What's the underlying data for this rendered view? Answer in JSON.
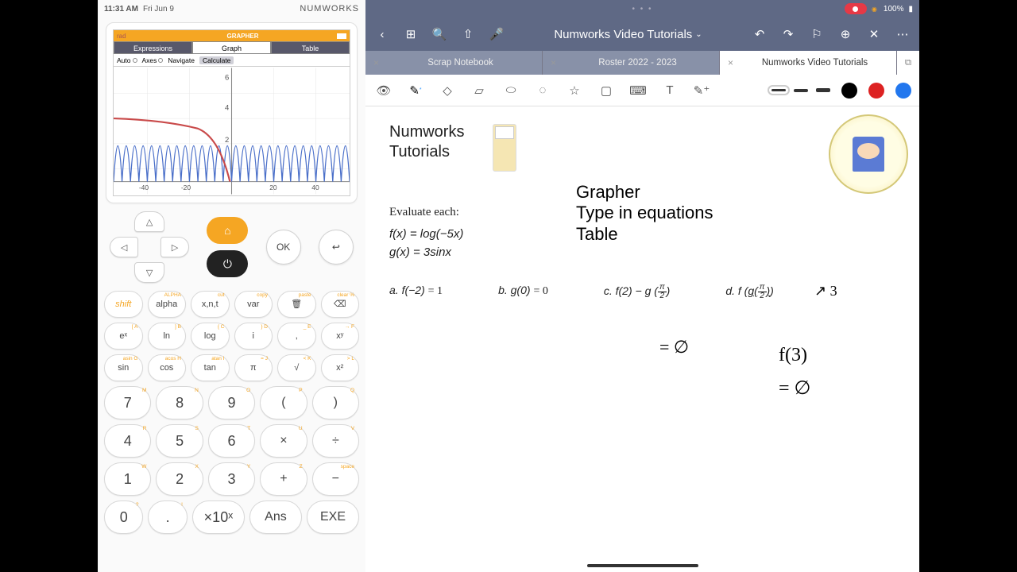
{
  "calc_status": {
    "time": "11:31 AM",
    "date": "Fri Jun 9",
    "brand": "NUMWORKS"
  },
  "screen": {
    "mode": "rad",
    "app_title": "GRAPHER",
    "tabs": [
      "Expressions",
      "Graph",
      "Table"
    ],
    "active_tab": 1,
    "toolbar": {
      "auto": "Auto",
      "axes": "Axes",
      "navigate": "Navigate",
      "calculate": "Calculate"
    },
    "y_ticks": [
      "6",
      "4",
      "2"
    ],
    "x_ticks": [
      "-40",
      "-20",
      "20",
      "40"
    ]
  },
  "nav": {
    "ok": "OK",
    "back": "↩"
  },
  "func_keys": [
    [
      {
        "m": "shift",
        "s": ""
      },
      {
        "m": "alpha",
        "s": "ALPHA"
      },
      {
        "m": "x,n,t",
        "s": "cut"
      },
      {
        "m": "var",
        "s": "copy"
      },
      {
        "m": "🗑",
        "s": "paste"
      },
      {
        "m": "⌫",
        "s": "clear %"
      }
    ],
    [
      {
        "m": "eˣ",
        "s": "[  A"
      },
      {
        "m": "ln",
        "s": "]  B"
      },
      {
        "m": "log",
        "s": "{  C"
      },
      {
        "m": "i",
        "s": "}  D"
      },
      {
        "m": ",",
        "s": "_  E"
      },
      {
        "m": "xʸ",
        "s": "→  F"
      }
    ],
    [
      {
        "m": "sin",
        "s": "asin G"
      },
      {
        "m": "cos",
        "s": "acos H"
      },
      {
        "m": "tan",
        "s": "atan I"
      },
      {
        "m": "π",
        "s": "=  J"
      },
      {
        "m": "√",
        "s": "<  K"
      },
      {
        "m": "x²",
        "s": ">  L"
      }
    ]
  ],
  "num_keys": [
    [
      {
        "m": "7",
        "s": "M"
      },
      {
        "m": "8",
        "s": "N"
      },
      {
        "m": "9",
        "s": "O"
      },
      {
        "m": "(",
        "s": "P"
      },
      {
        "m": ")",
        "s": "Q"
      }
    ],
    [
      {
        "m": "4",
        "s": "R"
      },
      {
        "m": "5",
        "s": "S"
      },
      {
        "m": "6",
        "s": "T"
      },
      {
        "m": "×",
        "s": "U"
      },
      {
        "m": "÷",
        "s": "V"
      }
    ],
    [
      {
        "m": "1",
        "s": "W"
      },
      {
        "m": "2",
        "s": "X"
      },
      {
        "m": "3",
        "s": "Y"
      },
      {
        "m": "+",
        "s": "Z"
      },
      {
        "m": "−",
        "s": "space"
      }
    ],
    [
      {
        "m": "0",
        "s": "?"
      },
      {
        "m": ".",
        "s": "!"
      },
      {
        "m": "×10ˣ",
        "s": ""
      },
      {
        "m": "Ans",
        "s": ""
      },
      {
        "m": "EXE",
        "s": ""
      }
    ]
  ],
  "note": {
    "status": {
      "battery": "100%"
    },
    "toolbar": {
      "title": "Numworks Video Tutorials"
    },
    "tabs": [
      {
        "label": "Scrap Notebook",
        "active": false
      },
      {
        "label": "Roster 2022 - 2023",
        "active": false
      },
      {
        "label": "Numworks Video Tutorials",
        "active": true
      }
    ],
    "content": {
      "heading1": "Numworks",
      "heading2": "Tutorials",
      "prompt": "Evaluate each:",
      "eq1": "f(x) = log(−5x)",
      "eq2": "g(x) = 3sinx",
      "qa_label": "a.",
      "qa": "f(−2)",
      "qb_label": "b.",
      "qb": "g(0)",
      "qc_label": "c.",
      "qc": "f(2) − g",
      "qd_label": "d.",
      "qd": "f",
      "hand1": "Grapher",
      "hand2": "Type in equations",
      "hand3": "Table",
      "hand_a": "= 1",
      "hand_b": "= 0",
      "hand_c": "= ∅",
      "hand_d1": "↗ 3",
      "hand_d2": "f(3)",
      "hand_d3": "= ∅"
    }
  }
}
